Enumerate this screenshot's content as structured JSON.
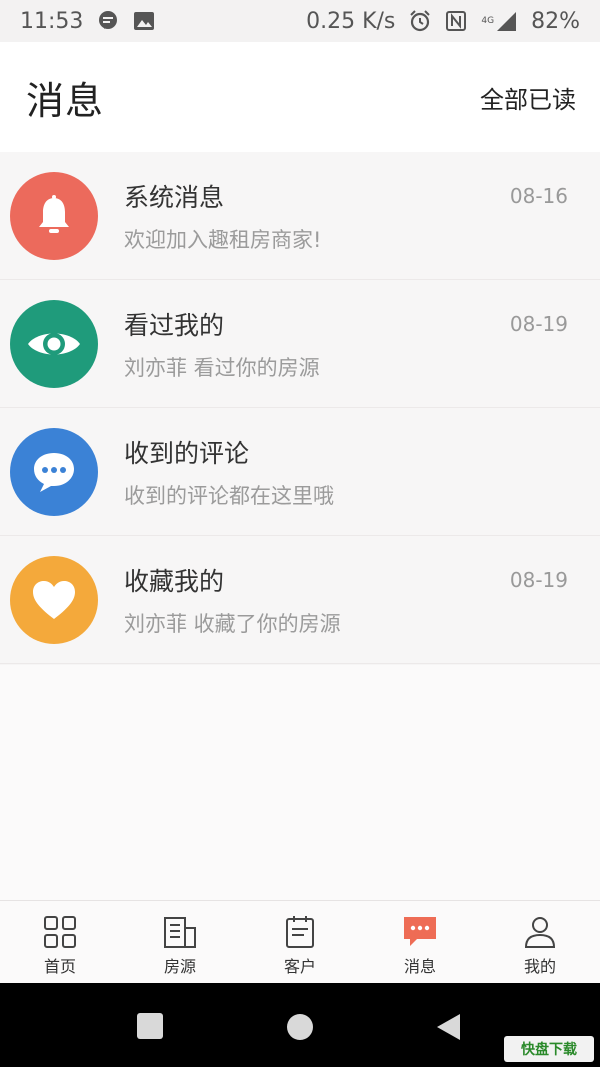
{
  "status_bar": {
    "time": "11:53",
    "speed": "0.25 K/s",
    "network": "4G",
    "battery": "82%"
  },
  "header": {
    "title": "消息",
    "mark_all_read": "全部已读"
  },
  "messages": [
    {
      "title": "系统消息",
      "subtitle": "欢迎加入趣租房商家!",
      "date": "08-16",
      "icon": "bell-icon",
      "color": "#ec6a5c"
    },
    {
      "title": "看过我的",
      "subtitle": "刘亦菲 看过你的房源",
      "date": "08-19",
      "icon": "eye-icon",
      "color": "#1f9b7b"
    },
    {
      "title": "收到的评论",
      "subtitle": "收到的评论都在这里哦",
      "date": "",
      "icon": "comment-icon",
      "color": "#3b82d6"
    },
    {
      "title": "收藏我的",
      "subtitle": "刘亦菲 收藏了你的房源",
      "date": "08-19",
      "icon": "heart-icon",
      "color": "#f4a93b"
    }
  ],
  "tabs": [
    {
      "label": "首页",
      "icon": "grid-icon"
    },
    {
      "label": "房源",
      "icon": "building-icon"
    },
    {
      "label": "客户",
      "icon": "notepad-icon"
    },
    {
      "label": "消息",
      "icon": "message-icon",
      "active": true,
      "active_color": "#ee6c55"
    },
    {
      "label": "我的",
      "icon": "person-icon"
    }
  ],
  "watermark": "快盘下载"
}
